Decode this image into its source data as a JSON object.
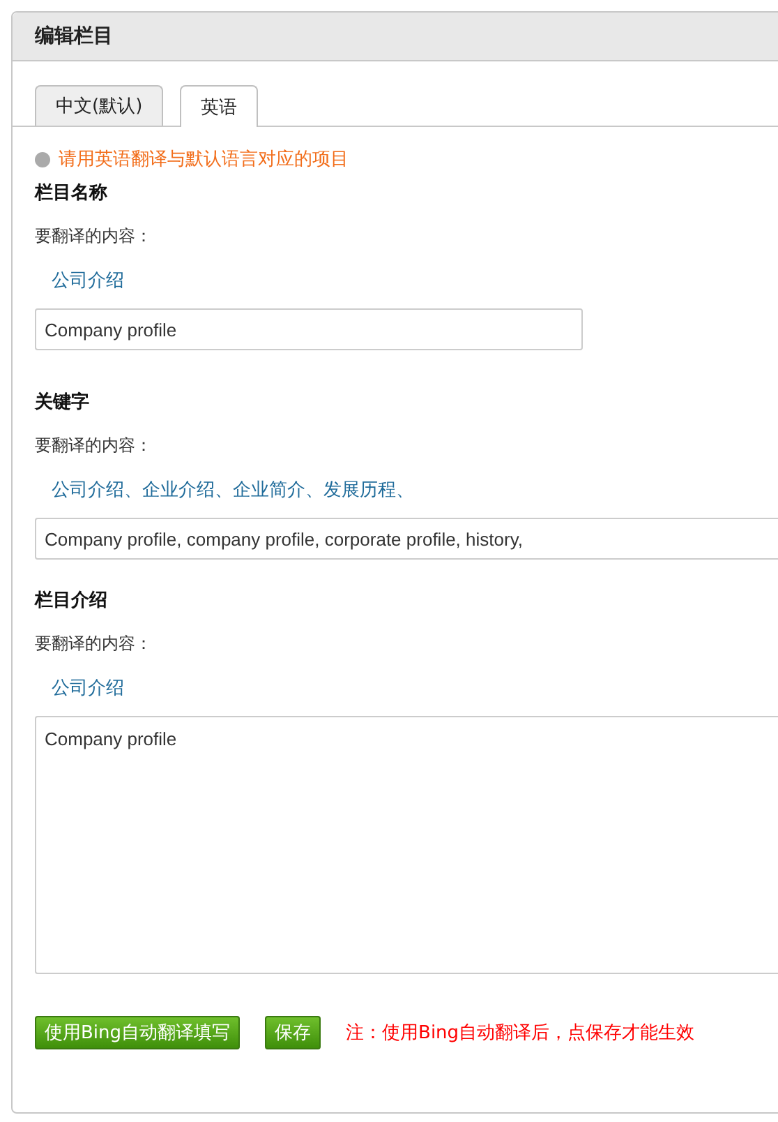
{
  "panel": {
    "title": "编辑栏目"
  },
  "tabs": [
    {
      "label": "中文(默认)",
      "selected": false
    },
    {
      "label": "英语",
      "selected": true
    }
  ],
  "notice": "请用英语翻译与默认语言对应的项目",
  "sections": [
    {
      "heading": "栏目名称",
      "source_label": "要翻译的内容：",
      "source_text": "公司介绍",
      "kind": "short-input",
      "value": "Company profile"
    },
    {
      "heading": "关键字",
      "source_label": "要翻译的内容：",
      "source_text": "公司介绍、企业介绍、企业简介、发展历程、",
      "kind": "wide-input",
      "value": "Company profile, company profile, corporate profile, history,"
    },
    {
      "heading": "栏目介绍",
      "source_label": "要翻译的内容：",
      "source_text": "公司介绍",
      "kind": "textarea",
      "value": "Company profile"
    }
  ],
  "buttons": [
    {
      "label": "使用Bing自动翻译填写"
    },
    {
      "label": "保存"
    }
  ],
  "note": "注：使用Bing自动翻译后，点保存才能生效"
}
